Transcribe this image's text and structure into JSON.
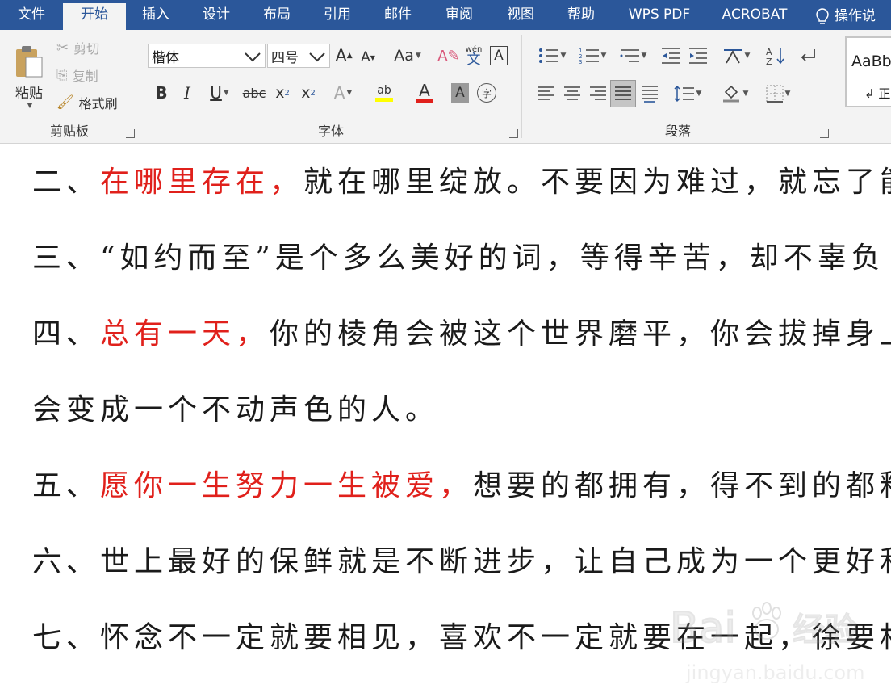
{
  "tabs": [
    {
      "label": "文件",
      "active": false
    },
    {
      "label": "开始",
      "active": true
    },
    {
      "label": "插入",
      "active": false
    },
    {
      "label": "设计",
      "active": false
    },
    {
      "label": "布局",
      "active": false
    },
    {
      "label": "引用",
      "active": false
    },
    {
      "label": "邮件",
      "active": false
    },
    {
      "label": "审阅",
      "active": false
    },
    {
      "label": "视图",
      "active": false
    },
    {
      "label": "帮助",
      "active": false
    },
    {
      "label": "WPS PDF",
      "active": false
    },
    {
      "label": "ACROBAT",
      "active": false
    }
  ],
  "help_search": {
    "label": "操作说",
    "icon": "lightbulb-icon"
  },
  "clipboard": {
    "group_label": "剪贴板",
    "paste_label": "粘贴",
    "cut_label": "剪切",
    "copy_label": "复制",
    "format_painter_label": "格式刷"
  },
  "font": {
    "group_label": "字体",
    "font_name": "楷体",
    "font_size": "四号",
    "grow_label": "A",
    "shrink_label": "A",
    "case_label": "Aa",
    "phonetic_label": "wén",
    "phonetic_char": "文",
    "border_char": "A",
    "bold": "B",
    "italic": "I",
    "underline": "U",
    "strike": "abc",
    "subscript": "x",
    "sub_digit": "2",
    "superscript": "x",
    "sup_digit": "2",
    "effects": "A",
    "highlight": "ab",
    "font_color": "A",
    "shading": "A",
    "enclose": "字",
    "highlight_color": "#ffff00",
    "font_color_value": "#e0201b"
  },
  "paragraph": {
    "group_label": "段落"
  },
  "styles": {
    "preview": "AaBb",
    "name": "↲ 正"
  },
  "document": {
    "lines": [
      {
        "parts": [
          {
            "text": "二、",
            "red": false
          },
          {
            "text": "在哪里存在，",
            "red": true
          },
          {
            "text": "就在哪里绽放。不要因为难过，就忘了能",
            "red": false
          }
        ]
      },
      {
        "parts": [
          {
            "text": "三、“如约而至”是个多么美好的词，等得辛苦，却不辜负",
            "red": false
          }
        ]
      },
      {
        "parts": [
          {
            "text": "四、",
            "red": false
          },
          {
            "text": "总有一天，",
            "red": true
          },
          {
            "text": "你的棱角会被这个世界磨平，你会拔掉身上",
            "red": false
          }
        ]
      },
      {
        "parts": [
          {
            "text": "会变成一个不动声色的人。",
            "red": false
          }
        ]
      },
      {
        "parts": [
          {
            "text": "五、",
            "red": false
          },
          {
            "text": "愿你一生努力一生被爱，",
            "red": true
          },
          {
            "text": "想要的都拥有，得不到的都释",
            "red": false
          }
        ]
      },
      {
        "parts": [
          {
            "text": "六、世上最好的保鲜就是不断进步，让自己成为一个更好和",
            "red": false
          }
        ]
      },
      {
        "parts": [
          {
            "text": "七、怀念不一定就要相见，喜欢不一定就要在一起，徐要相",
            "red": false
          }
        ]
      }
    ],
    "text_color": "#1a1a1a",
    "emphasis_color": "#e0201b"
  },
  "watermark": {
    "brand": "Bai",
    "brand2": "经验",
    "url": "jingyan.baidu.com"
  },
  "colors": {
    "ribbon_blue": "#2b579a",
    "ribbon_bg": "#f3f3f3"
  }
}
